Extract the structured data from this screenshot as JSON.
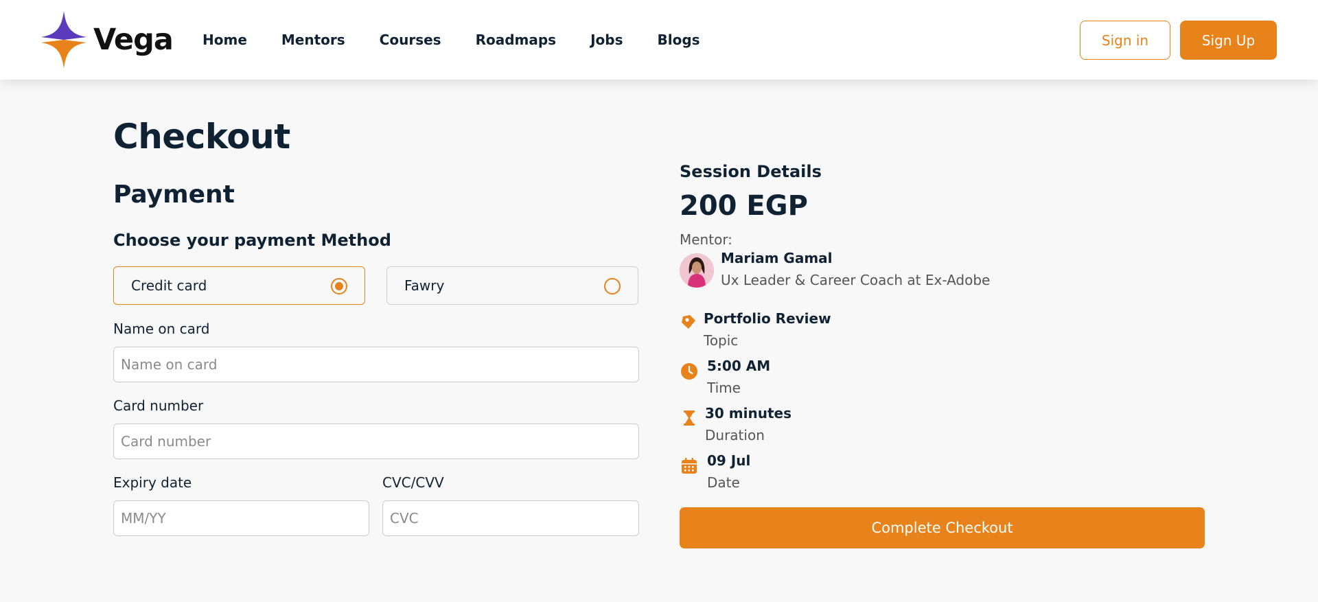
{
  "brand": {
    "name": "Vega",
    "accent": "#e8821a",
    "logo_primary": "#5b3bbd",
    "logo_secondary": "#e8821a"
  },
  "nav": [
    "Home",
    "Mentors",
    "Courses",
    "Roadmaps",
    "Jobs",
    "Blogs"
  ],
  "auth": {
    "signin": "Sign in",
    "signup": "Sign Up"
  },
  "page": {
    "title": "Checkout",
    "subtitle": "Payment",
    "choose": "Choose your payment Method"
  },
  "payment_methods": [
    {
      "label": "Credit card",
      "selected": true
    },
    {
      "label": "Fawry",
      "selected": false
    }
  ],
  "form": {
    "name": {
      "label": "Name on card",
      "placeholder": "Name on card",
      "value": ""
    },
    "card": {
      "label": "Card number",
      "placeholder": "Card number",
      "value": ""
    },
    "expiry": {
      "label": "Expiry date",
      "placeholder": "MM/YY",
      "value": ""
    },
    "cvc": {
      "label": "CVC/CVV",
      "placeholder": "CVC",
      "value": ""
    }
  },
  "session": {
    "title": "Session Details",
    "price": "200 EGP",
    "mentor_label": "Mentor:",
    "mentor_name": "Mariam Gamal",
    "mentor_role": "Ux Leader & Career Coach at Ex-Adobe",
    "details": [
      {
        "icon": "tag-icon",
        "value": "Portfolio Review",
        "label": "Topic"
      },
      {
        "icon": "clock-icon",
        "value": "5:00 AM",
        "label": "Time"
      },
      {
        "icon": "hourglass-icon",
        "value": "30 minutes",
        "label": "Duration"
      },
      {
        "icon": "calendar-icon",
        "value": "09 Jul",
        "label": "Date"
      }
    ]
  },
  "checkout_button": "Complete Checkout"
}
